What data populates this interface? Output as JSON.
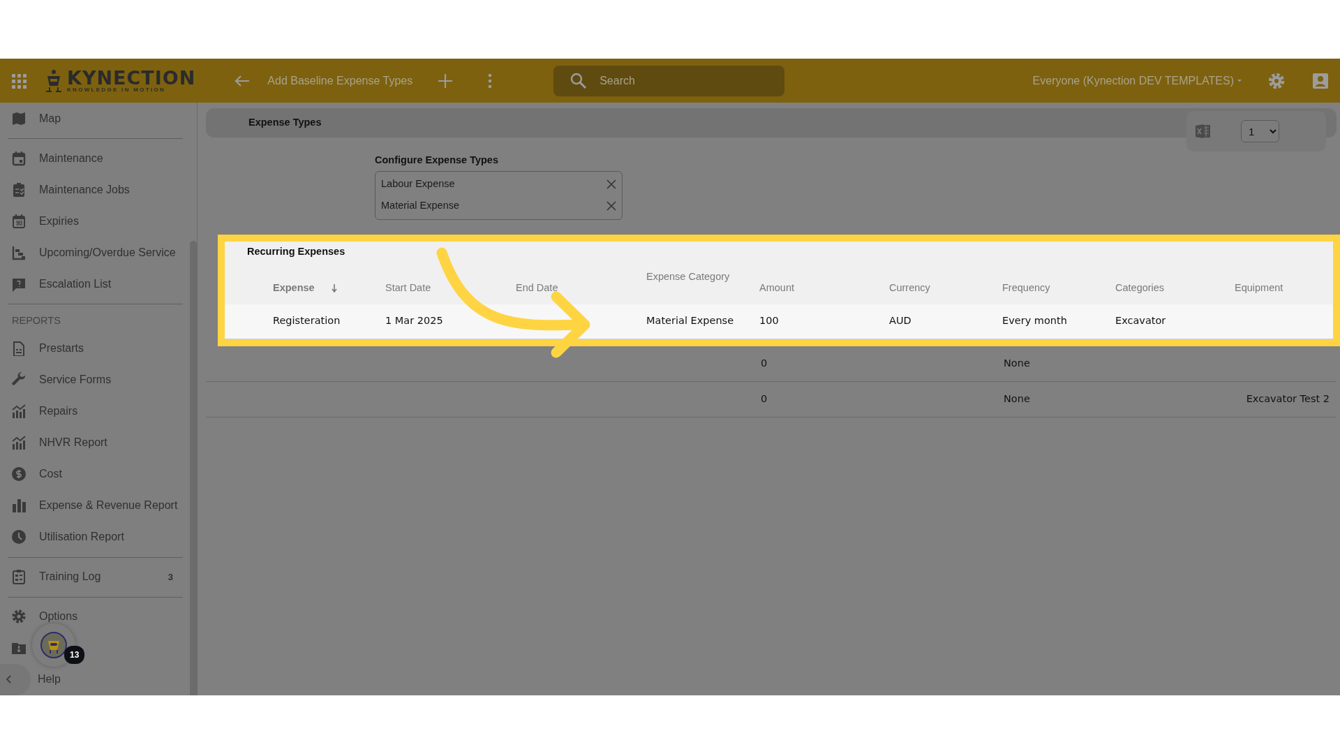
{
  "topbar": {
    "logo": {
      "name": "KYNECTION",
      "tagline": "KNOWLEDGE IN MOTION"
    },
    "page_title": "Add Baseline Expense Types",
    "search": {
      "placeholder": "Search"
    },
    "scope": "Everyone (Kynection DEV TEMPLATES)"
  },
  "sidebar": {
    "items": [
      {
        "kind": "item",
        "label": "Map"
      },
      {
        "kind": "divider"
      },
      {
        "kind": "item",
        "label": "Maintenance"
      },
      {
        "kind": "item",
        "label": "Maintenance Jobs"
      },
      {
        "kind": "item",
        "label": "Expiries"
      },
      {
        "kind": "item",
        "label": "Upcoming/Overdue Service"
      },
      {
        "kind": "item",
        "label": "Escalation List"
      },
      {
        "kind": "divider"
      },
      {
        "kind": "heading",
        "label": "REPORTS"
      },
      {
        "kind": "item",
        "label": "Prestarts"
      },
      {
        "kind": "item",
        "label": "Service Forms"
      },
      {
        "kind": "item",
        "label": "Repairs"
      },
      {
        "kind": "item",
        "label": "NHVR Report"
      },
      {
        "kind": "item",
        "label": "Cost"
      },
      {
        "kind": "item",
        "label": "Expense & Revenue Report"
      },
      {
        "kind": "item",
        "label": "Utilisation Report"
      },
      {
        "kind": "divider"
      },
      {
        "kind": "item",
        "label": "Training Log",
        "count": "3"
      },
      {
        "kind": "divider"
      },
      {
        "kind": "item",
        "label": "Options"
      },
      {
        "kind": "icon_item"
      },
      {
        "kind": "collapse",
        "label": "Help"
      }
    ],
    "assistant": {
      "badge": "13"
    }
  },
  "header": {
    "title": "Expense Types",
    "page_select": "1"
  },
  "configure": {
    "label": "Configure Expense Types",
    "chips": [
      "Labour Expense",
      "Material Expense"
    ]
  },
  "recurring": {
    "title": "Recurring Expenses",
    "columns": [
      {
        "label": "Expense",
        "sorted": true
      },
      {
        "label": "Start Date",
        "sorted": false
      },
      {
        "label": "End Date",
        "sorted": false
      },
      {
        "label": "Expense Category",
        "sorted": false
      },
      {
        "label": "Amount",
        "sorted": false
      },
      {
        "label": "Currency",
        "sorted": false
      },
      {
        "label": "Frequency",
        "sorted": false
      },
      {
        "label": "Categories",
        "sorted": false
      },
      {
        "label": "Equipment",
        "sorted": false
      }
    ],
    "rows": [
      {
        "highlighted": true,
        "cells": [
          "Registeration",
          "1 Mar 2025",
          null,
          "Material Expense",
          "100",
          "AUD",
          "Every month",
          "Excavator",
          null
        ]
      },
      {
        "highlighted": false,
        "cells": [
          null,
          null,
          null,
          null,
          "0",
          null,
          "None",
          null,
          null
        ]
      },
      {
        "highlighted": false,
        "cells": [
          null,
          null,
          null,
          null,
          "0",
          null,
          "None",
          null,
          "Excavator Test 2"
        ]
      }
    ]
  }
}
